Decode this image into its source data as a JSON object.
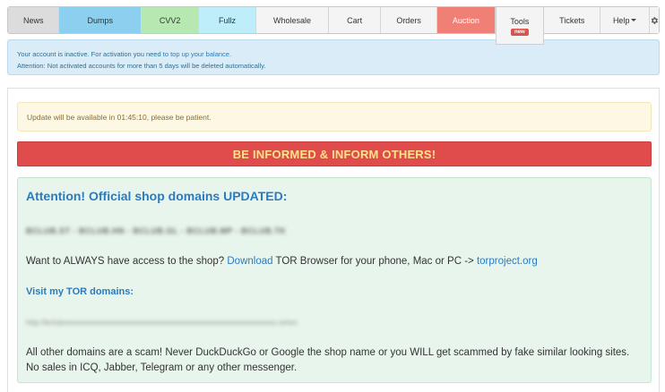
{
  "nav": {
    "items": [
      {
        "label": "News"
      },
      {
        "label": "Dumps"
      },
      {
        "label": "CVV2"
      },
      {
        "label": "Fullz"
      },
      {
        "label": "Wholesale"
      },
      {
        "label": "Cart"
      },
      {
        "label": "Orders"
      },
      {
        "label": "Auction"
      },
      {
        "label": "Tools",
        "badge": "new"
      },
      {
        "label": "Tickets"
      },
      {
        "label": "Help"
      }
    ],
    "settings_icon": "gear-icon"
  },
  "account_notice": {
    "line1_prefix": "Your account is inactive. For activation you need ",
    "line1_link": "to top up your balance",
    "line1_suffix": ".",
    "line2": "Attention: Not activated accounts for more than 5 days will be deleted automatically."
  },
  "update_notice": "Update will be available in 01:45:10, please be patient.",
  "banner": "BE INFORMED & INFORM OTHERS!",
  "info": {
    "title": "Attention! Official shop domains UPDATED:",
    "blurred_domains": "BCLUB.ST - BCLUB.HN - BCLUB.GL - BCLUB.MP - BCLUB.TK",
    "download_prefix": "Want to ALWAYS have access to the shop? ",
    "download_link": "Download",
    "download_middle": " TOR Browser for your phone, Mac or PC -> ",
    "tor_link": "torproject.org",
    "tor_heading": "Visit my TOR domains:",
    "blurred_tor": "http://bclubxxxxxxxxxxxxxxxxxxxxxxxxxxxxxxxxxxxxxxxxxxxxxxxxxxxxxxxx.onion",
    "scam_warning": "All other domains are a scam! Never DuckDuckGo or Google the shop name or you WILL get scammed by fake similar looking sites. No sales in ICQ, Jabber, Telegram or any other messenger."
  }
}
